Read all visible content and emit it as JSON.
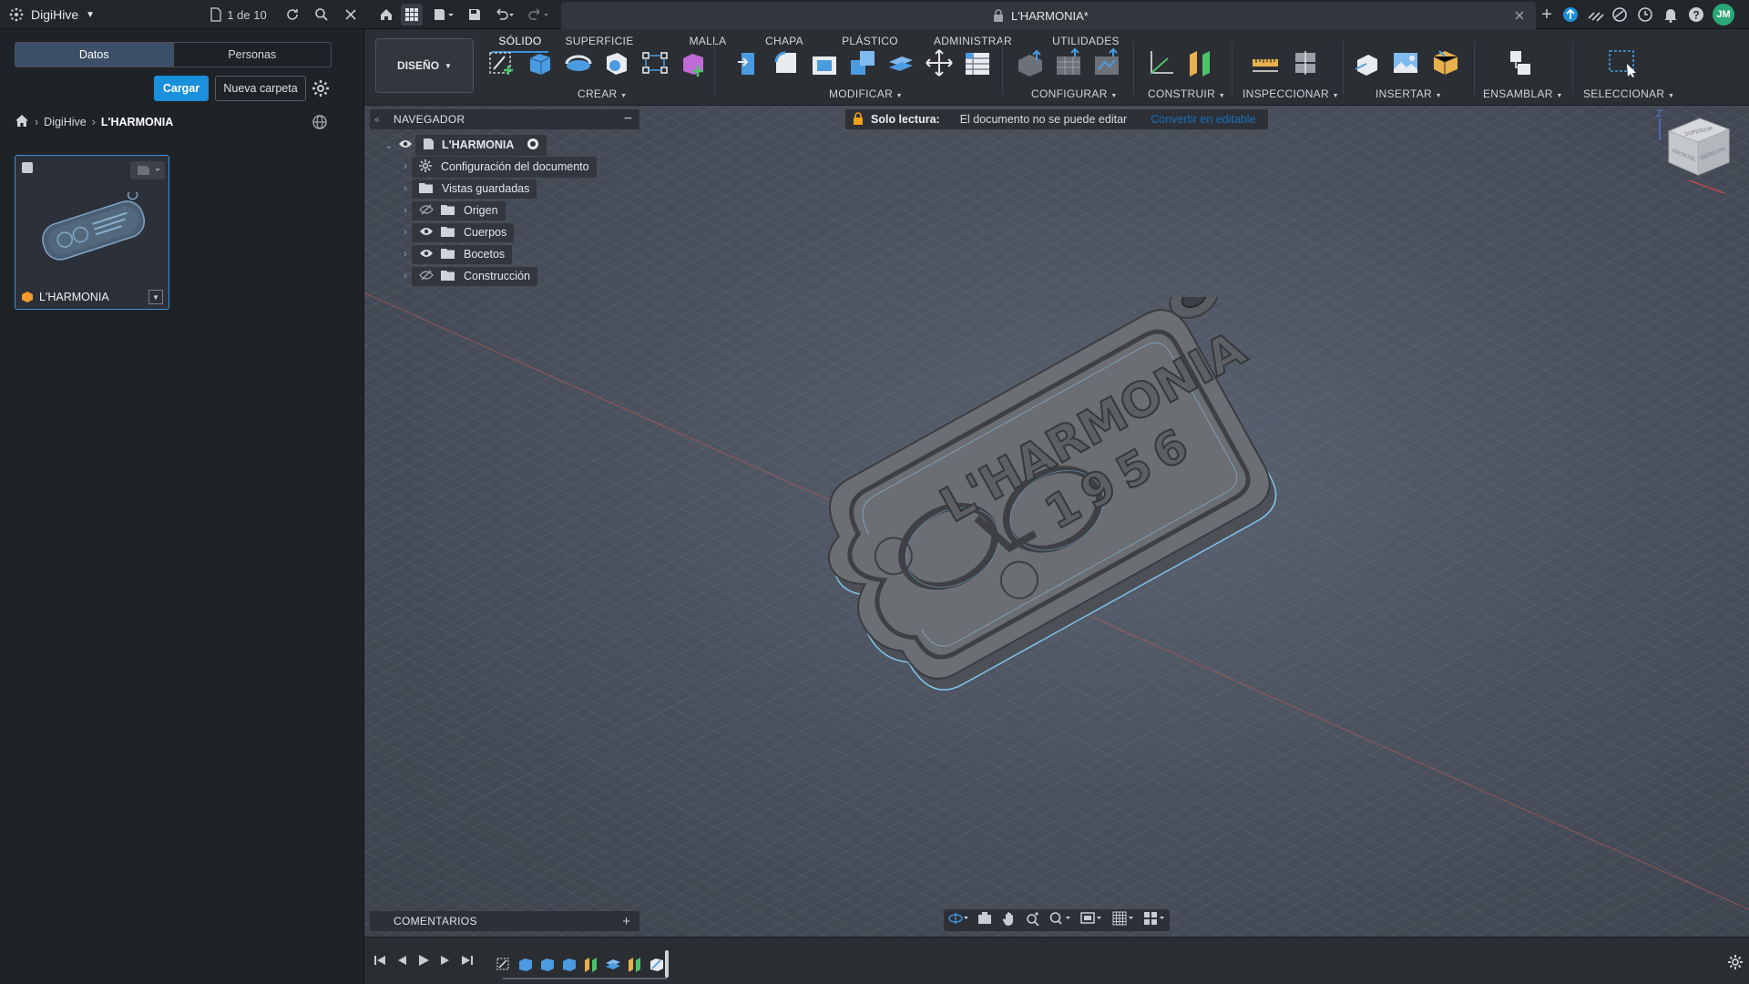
{
  "topbar": {
    "app_name": "DigiHive",
    "page_counter": "1 de 10",
    "document_title": "L'HARMONIA*",
    "user_initials": "JM"
  },
  "left": {
    "tabs": [
      "Datos",
      "Personas"
    ],
    "upload_label": "Cargar",
    "new_folder_label": "Nueva carpeta",
    "breadcrumb": [
      "DigiHive",
      "L'HARMONIA"
    ],
    "file_card_name": "L'HARMONIA"
  },
  "ribbon": {
    "workspace": "DISEÑO",
    "tabs": [
      "SÓLIDO",
      "SUPERFICIE",
      "MALLA",
      "CHAPA",
      "PLÁSTICO",
      "ADMINISTRAR",
      "UTILIDADES"
    ],
    "groups": {
      "crear": "CREAR",
      "modificar": "MODIFICAR",
      "configurar": "CONFIGURAR",
      "construir": "CONSTRUIR",
      "inspeccionar": "INSPECCIONAR",
      "insertar": "INSERTAR",
      "ensamblar": "ENSAMBLAR",
      "seleccionar": "SELECCIONAR"
    }
  },
  "navigator": {
    "title": "NAVEGADOR",
    "root": "L'HARMONIA",
    "items": [
      "Configuración del documento",
      "Vistas guardadas",
      "Origen",
      "Cuerpos",
      "Bocetos",
      "Construcción"
    ]
  },
  "readonly": {
    "label": "Solo lectura:",
    "message": "El documento no se puede editar",
    "action": "Convertir en editable"
  },
  "model_text": {
    "name": "L'HARMONIA",
    "year": "1956"
  },
  "viewcube": {
    "top_label": "SUPERIOR",
    "front_label": "FRONTAL",
    "right_label": "DERECHA",
    "z_axis": "Z"
  },
  "comments": {
    "title": "COMENTARIOS"
  },
  "colors": {
    "accent": "#1a8fdc",
    "model": "#6b6e73"
  }
}
